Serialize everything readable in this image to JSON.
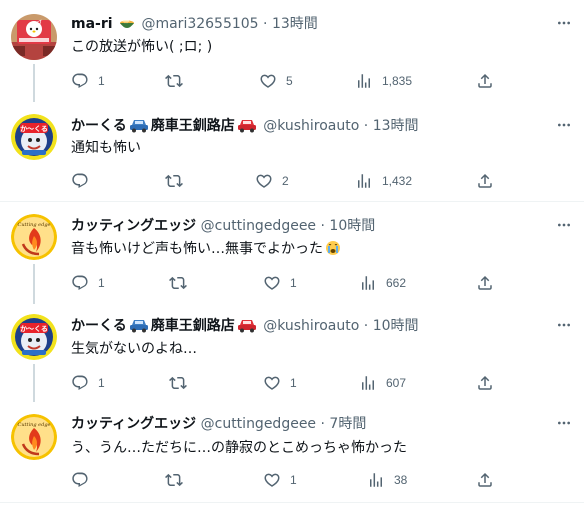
{
  "tweets": [
    {
      "name": "ma-ri",
      "handle": "@mari32655105",
      "time": "13時間",
      "text": "この放送が怖い( ;ロ; )",
      "replies": "1",
      "retweets": "",
      "likes": "5",
      "views": "1,835"
    },
    {
      "name": "かーくる",
      "name_suffix": "廃車王釧路店",
      "handle": "@kushiroauto",
      "time": "13時間",
      "text": "通知も怖い",
      "replies": "",
      "retweets": "",
      "likes": "2",
      "views": "1,432",
      "avatar_text": "か〜くる"
    },
    {
      "name": "カッティングエッジ",
      "handle": "@cuttingedgeee",
      "time": "10時間",
      "text": "音も怖いけど声も怖い…無事でよかった",
      "replies": "1",
      "retweets": "",
      "likes": "1",
      "views": "662",
      "avatar_text": "Cutting edge"
    },
    {
      "name": "かーくる",
      "name_suffix": "廃車王釧路店",
      "handle": "@kushiroauto",
      "time": "10時間",
      "text": "生気がないのよね…",
      "replies": "1",
      "retweets": "",
      "likes": "1",
      "views": "607",
      "avatar_text": "か〜くる"
    },
    {
      "name": "カッティングエッジ",
      "handle": "@cuttingedgeee",
      "time": "7時間",
      "text": "う、うん…ただちに…の静寂のとこめっちゃ怖かった",
      "replies": "",
      "retweets": "",
      "likes": "1",
      "views": "38",
      "avatar_text": "Cutting edge"
    }
  ],
  "dot": "·",
  "icons": [
    "reply-icon",
    "retweet-icon",
    "like-icon",
    "views-icon",
    "share-icon",
    "more-icon",
    "noodle-bowl-icon",
    "car-icon",
    "crying-face-icon"
  ],
  "colors": {
    "name": "#0f1419",
    "secondary": "#536471",
    "divider": "#eff3f4",
    "thread": "#cfd9de"
  }
}
